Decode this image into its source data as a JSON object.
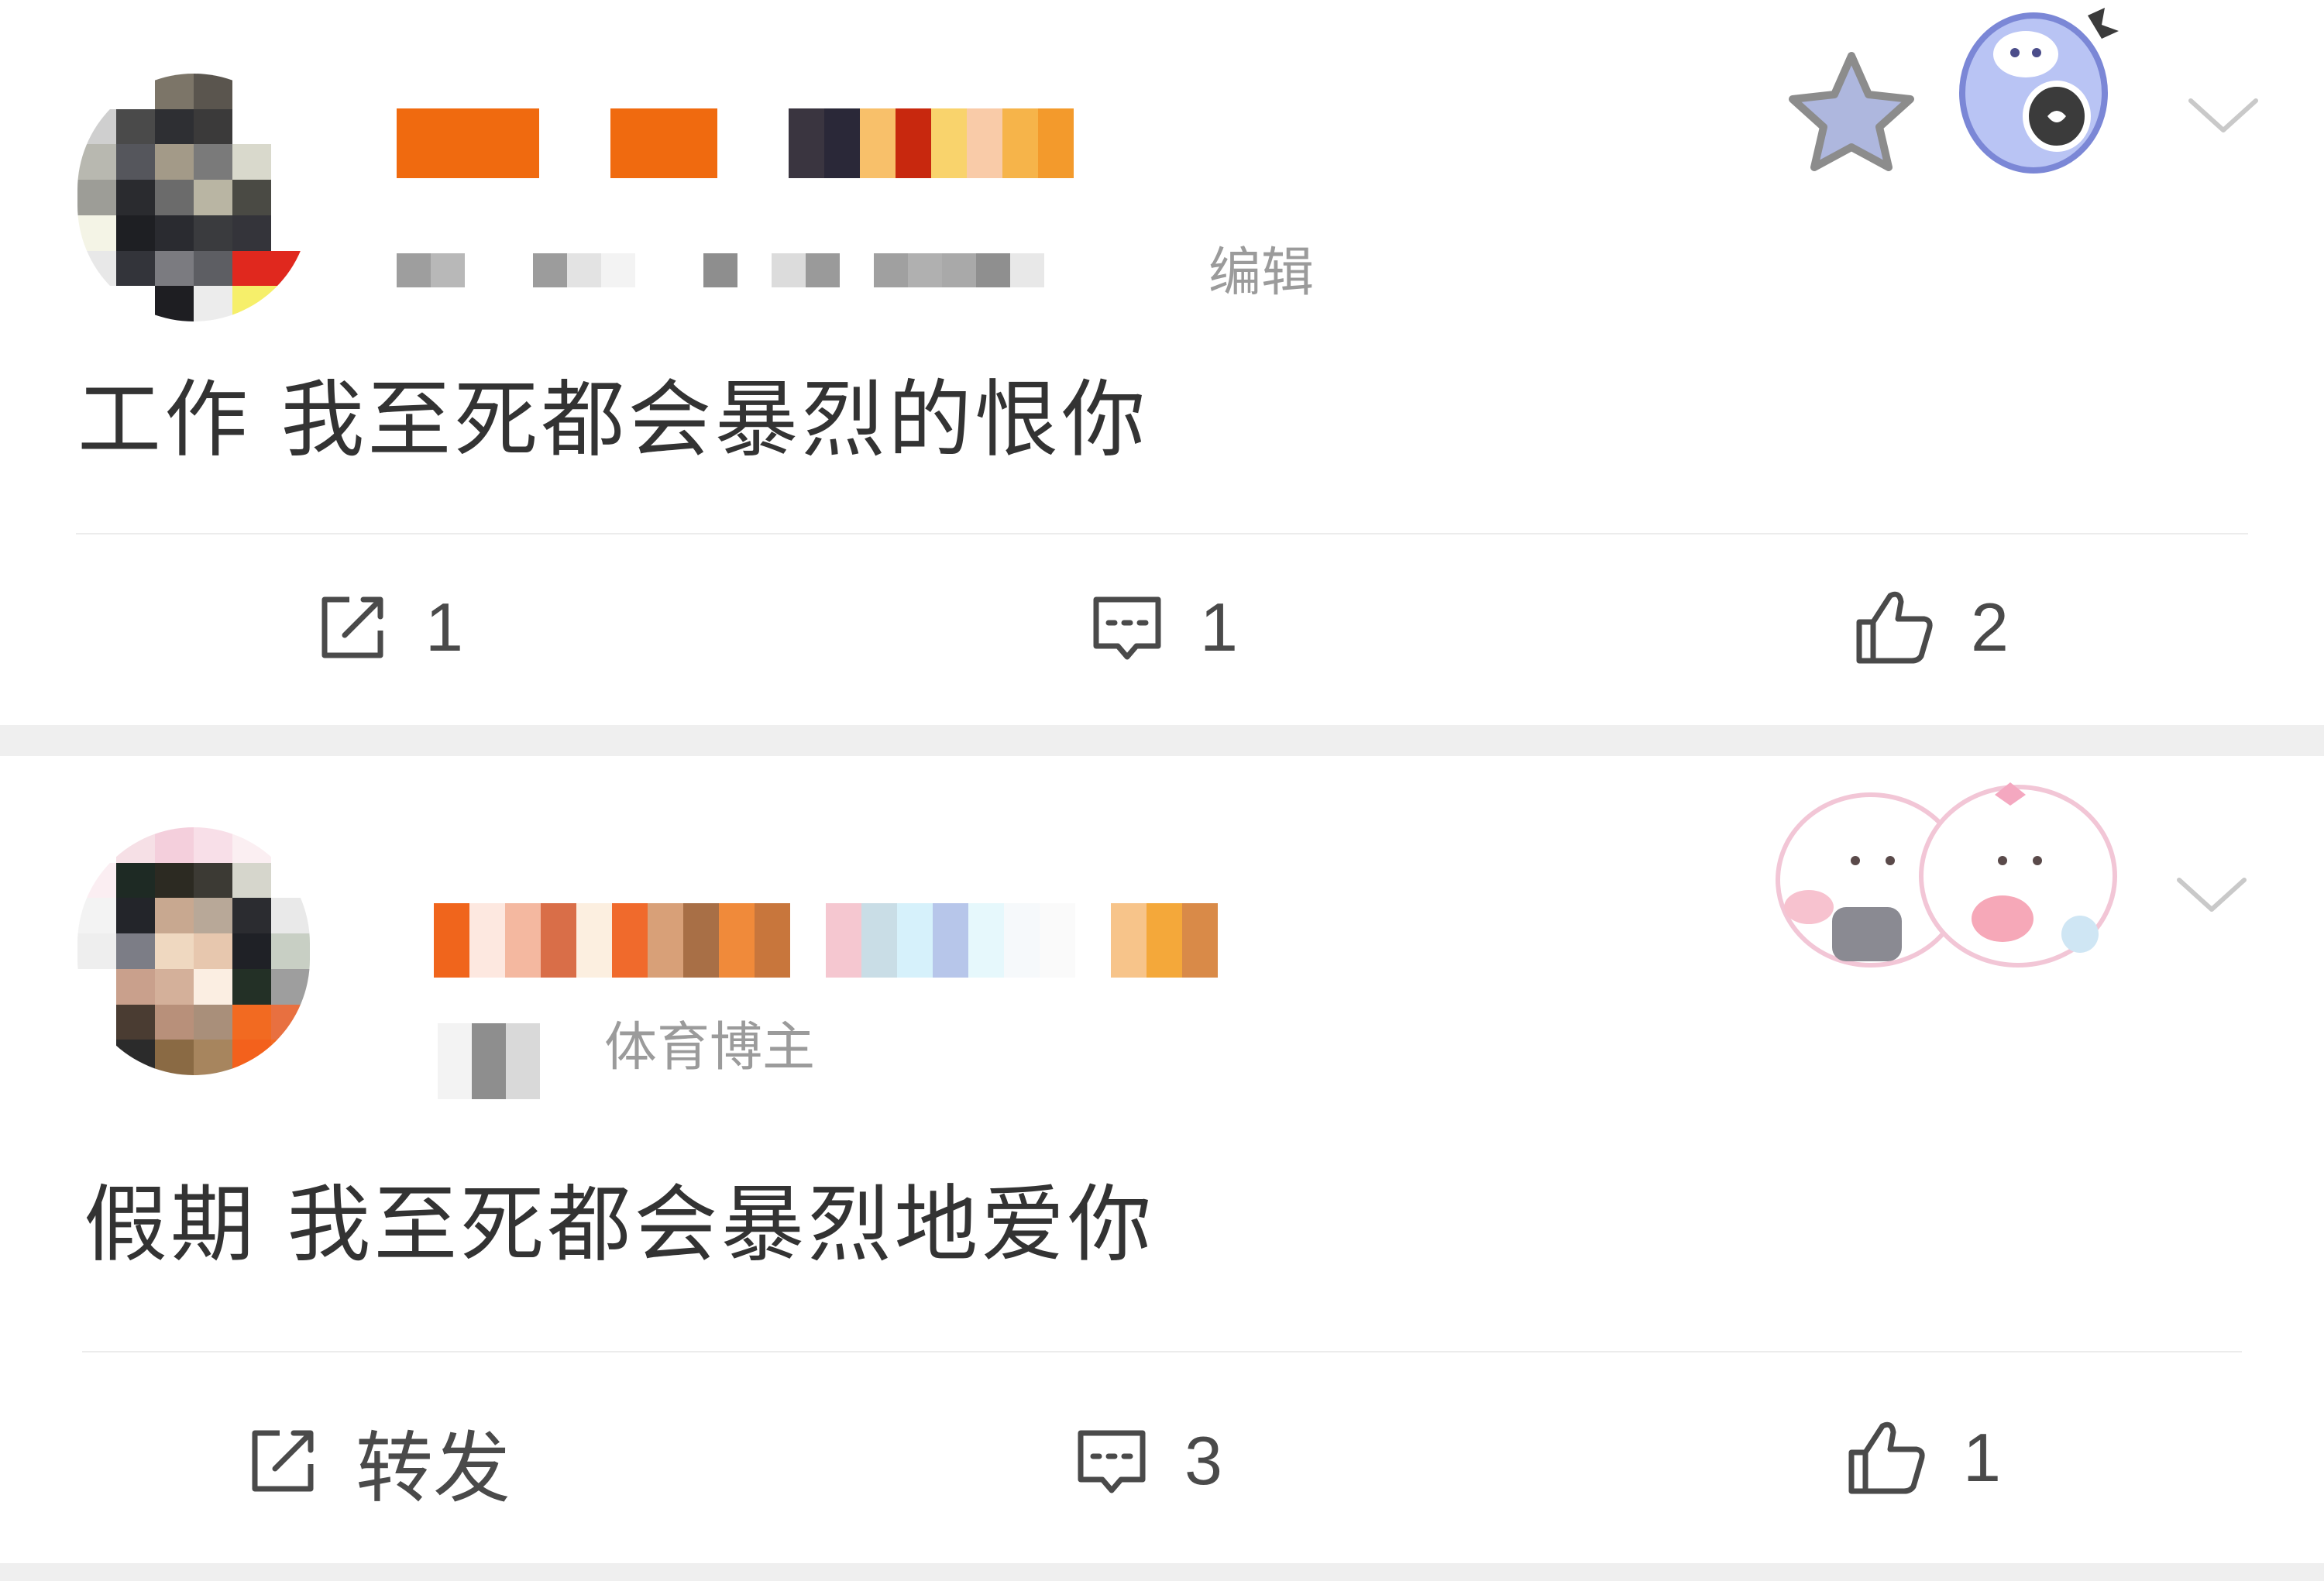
{
  "posts": [
    {
      "meta_suffix": "编辑",
      "content": "工作 我至死都会暴烈的恨你",
      "actions": {
        "repost": "1",
        "comment": "1",
        "like": "2"
      }
    },
    {
      "meta_suffix": "体育博主",
      "content": "假期 我至死都会暴烈地爱你",
      "actions": {
        "repost": "转发",
        "comment": "3",
        "like": "1"
      }
    }
  ],
  "icons": {
    "repost": "repost-icon",
    "comment": "comment-icon",
    "like": "thumbs-up-icon",
    "more": "chevron-down-icon"
  },
  "colors": {
    "text": "#333333",
    "meta": "#9b9b9b",
    "separator": "#efefef",
    "icon": "#4a4a4a"
  }
}
